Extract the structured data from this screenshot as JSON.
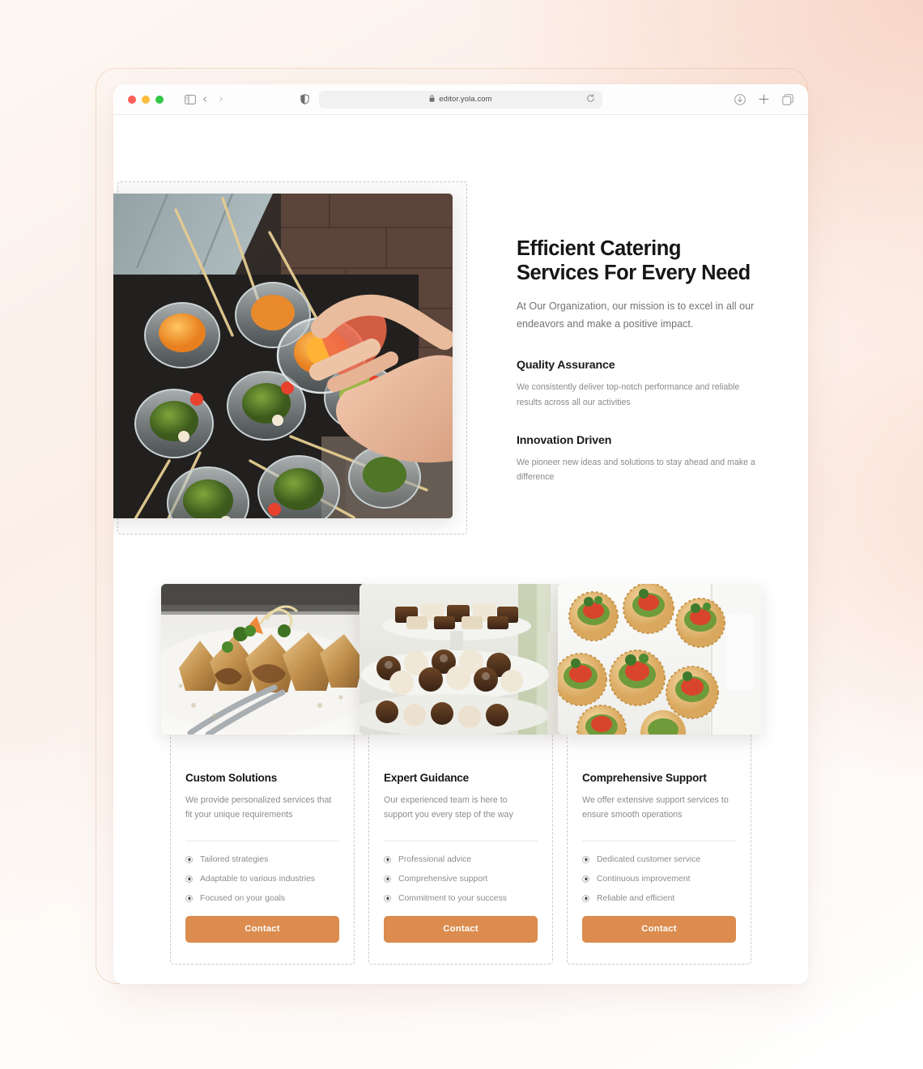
{
  "browser": {
    "traffic_lights": [
      "close",
      "minimize",
      "maximize"
    ],
    "sidebar_icon": "sidebar-icon",
    "back_label": "‹",
    "forward_label": "›",
    "shield_icon": "privacy-shield-icon",
    "lock_glyph": "🔒",
    "url": "editor.yola.com",
    "reload_glyph": "↻",
    "download_icon": "download-icon",
    "new_tab_glyph": "+",
    "tabs_icon": "tab-overview-icon"
  },
  "hero": {
    "image_alt": "catering-appetizer-glasses",
    "title": "Efficient Catering Services For Every Need",
    "subtitle": "At Our Organization, our mission is to excel in all our endeavors and make a positive impact.",
    "features": [
      {
        "title": "Quality Assurance",
        "body": "We consistently deliver top-notch performance and reliable results across all our activities"
      },
      {
        "title": "Innovation Driven",
        "body": "We pioneer new ideas and solutions to stay ahead and make a difference"
      }
    ]
  },
  "cards": [
    {
      "image_alt": "plated-pastry-dish",
      "title": "Custom Solutions",
      "description": "We provide personalized services that fit your unique requirements",
      "items": [
        "Tailored strategies",
        "Adaptable to various industries",
        "Focused on your goals"
      ],
      "button": "Contact"
    },
    {
      "image_alt": "dessert-tray-brownies",
      "title": "Expert Guidance",
      "description": "Our experienced team is here to support you every step of the way",
      "items": [
        "Professional advice",
        "Comprehensive support",
        "Commitment to your success"
      ],
      "button": "Contact"
    },
    {
      "image_alt": "canape-crackers-platter",
      "title": "Comprehensive Support",
      "description": "We offer extensive support services to ensure smooth operations",
      "items": [
        "Dedicated customer service",
        "Continuous improvement",
        "Reliable and efficient"
      ],
      "button": "Contact"
    }
  ],
  "colors": {
    "accent": "#DB8C4E",
    "heading": "#161616",
    "body_text": "#8C8C8C",
    "selection_border": "#C9C9C9"
  }
}
